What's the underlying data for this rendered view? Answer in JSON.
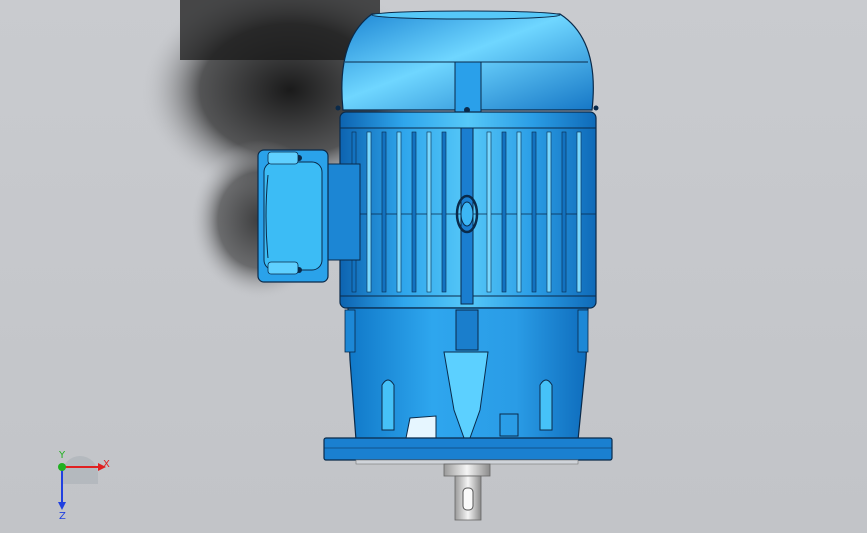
{
  "viewport": {
    "background": "#c6c8cc",
    "model": "electric-motor-flange-mount",
    "colors": {
      "body": "#1e8fd8",
      "body_light": "#4fc3f7",
      "body_dark": "#0b5fa8",
      "edge": "#0a2a4a",
      "shadow": "#2a2a2a",
      "shaft": "#e8e8e8"
    }
  },
  "triad": {
    "x_label": "X",
    "y_label": "Y",
    "z_label": "Z",
    "x_color": "#e02020",
    "y_color": "#20b020",
    "z_color": "#2040e0"
  }
}
